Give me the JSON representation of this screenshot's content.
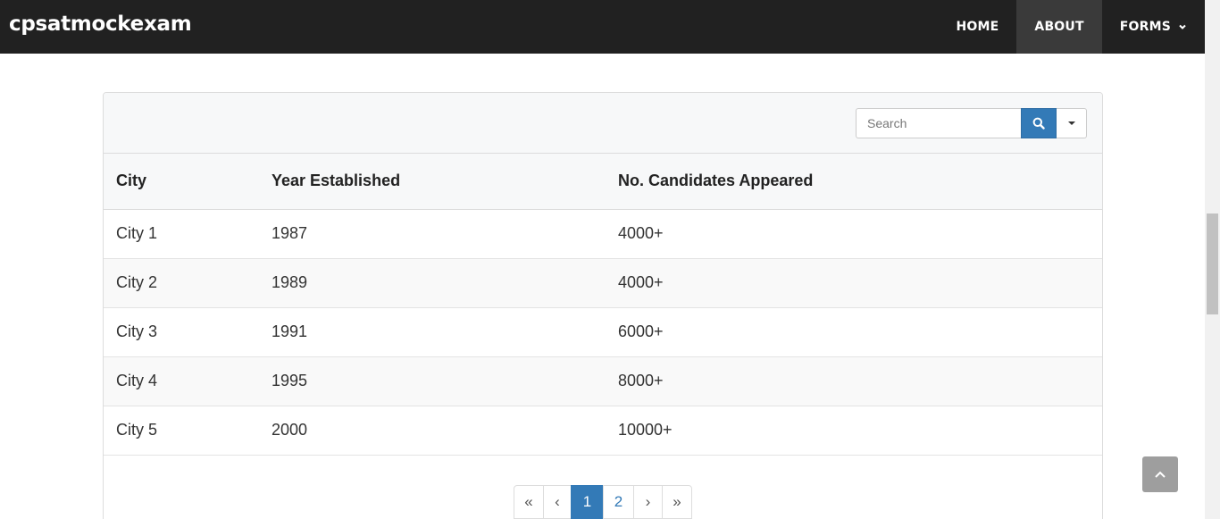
{
  "navbar": {
    "brand": "cpsatmockexam",
    "items": [
      {
        "label": "HOME"
      },
      {
        "label": "ABOUT"
      },
      {
        "label": "FORMS"
      }
    ]
  },
  "toolbar": {
    "search_placeholder": "Search"
  },
  "table": {
    "headers": [
      "City",
      "Year Established",
      "No. Candidates Appeared"
    ],
    "rows": [
      [
        "City 1",
        "1987",
        "4000+"
      ],
      [
        "City 2",
        "1989",
        "4000+"
      ],
      [
        "City 3",
        "1991",
        "6000+"
      ],
      [
        "City 4",
        "1995",
        "8000+"
      ],
      [
        "City 5",
        "2000",
        "10000+"
      ]
    ]
  },
  "pagination": {
    "first": "«",
    "prev": "‹",
    "pages": [
      "1",
      "2"
    ],
    "current_page": "1",
    "next": "›",
    "last": "»"
  },
  "colors": {
    "navbar_bg": "#212121",
    "active_nav_bg": "#3a3a3a",
    "accent": "#337ab7"
  },
  "icons": {
    "search_button": "search-icon",
    "dropdown_button": "caret-down-icon",
    "forms_dropdown": "chevron-down-icon",
    "back_to_top": "chevron-up-icon"
  }
}
